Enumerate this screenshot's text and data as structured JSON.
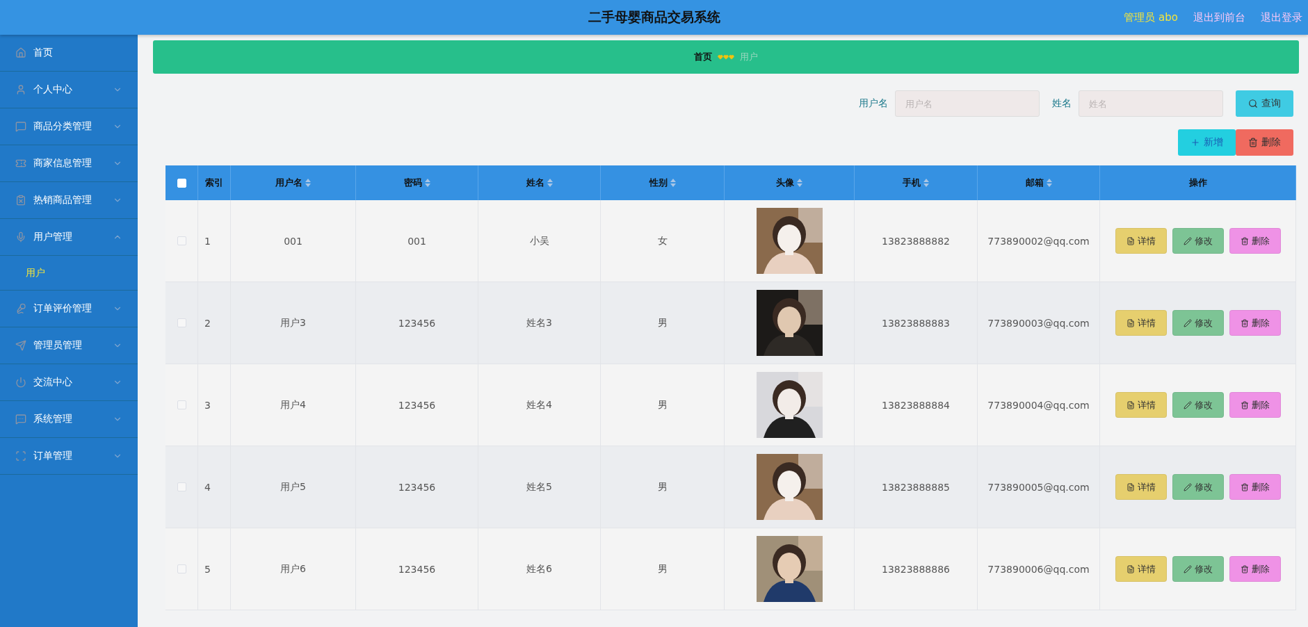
{
  "header": {
    "title": "二手母婴商品交易系统",
    "user": "管理员 abo",
    "links": [
      "退出到前台",
      "退出登录"
    ]
  },
  "sidebar": {
    "items": [
      {
        "label": "首页",
        "expandable": false
      },
      {
        "label": "个人中心",
        "expandable": true,
        "expanded": false
      },
      {
        "label": "商品分类管理",
        "expandable": true,
        "expanded": false
      },
      {
        "label": "商家信息管理",
        "expandable": true,
        "expanded": false
      },
      {
        "label": "热销商品管理",
        "expandable": true,
        "expanded": false
      },
      {
        "label": "用户管理",
        "expandable": true,
        "expanded": true,
        "children": [
          {
            "label": "用户",
            "selected": true
          }
        ]
      },
      {
        "label": "订单评价管理",
        "expandable": true,
        "expanded": false
      },
      {
        "label": "管理员管理",
        "expandable": true,
        "expanded": false
      },
      {
        "label": "交流中心",
        "expandable": true,
        "expanded": false
      },
      {
        "label": "系统管理",
        "expandable": true,
        "expanded": false
      },
      {
        "label": "订单管理",
        "expandable": true,
        "expanded": false
      }
    ]
  },
  "breadcrumb": {
    "items": [
      {
        "label": "首页",
        "current": false
      },
      {
        "label": "用户",
        "current": true
      }
    ]
  },
  "search": {
    "fields": [
      {
        "label": "用户名",
        "placeholder": "用户名"
      },
      {
        "label": "姓名",
        "placeholder": "姓名"
      }
    ],
    "button": "查询"
  },
  "actions": [
    {
      "label": "新增",
      "kind": "add"
    },
    {
      "label": "删除",
      "kind": "delete"
    }
  ],
  "table": {
    "checked_all": false,
    "columns": [
      {
        "label": "索引",
        "sortable": false
      },
      {
        "label": "用户名",
        "sortable": true
      },
      {
        "label": "密码",
        "sortable": true
      },
      {
        "label": "姓名",
        "sortable": true
      },
      {
        "label": "性别",
        "sortable": true
      },
      {
        "label": "头像",
        "sortable": true
      },
      {
        "label": "手机",
        "sortable": true
      },
      {
        "label": "邮箱",
        "sortable": true
      },
      {
        "label": "操作",
        "sortable": false
      }
    ],
    "rows": [
      {
        "checked": false,
        "cells": [
          "1",
          "001",
          "001",
          "小吴",
          "女"
        ],
        "phone": "13823888882",
        "email": "773890002@qq.com",
        "actions": [
          {
            "label": "详情",
            "kind": "detail"
          },
          {
            "label": "修改",
            "kind": "edit"
          },
          {
            "label": "删除",
            "kind": "delete"
          }
        ]
      },
      {
        "checked": false,
        "cells": [
          "2",
          "用户3",
          "123456",
          "姓名3",
          "男"
        ],
        "phone": "13823888883",
        "email": "773890003@qq.com",
        "actions": [
          {
            "label": "详情",
            "kind": "detail"
          },
          {
            "label": "修改",
            "kind": "edit"
          },
          {
            "label": "删除",
            "kind": "delete"
          }
        ]
      },
      {
        "checked": false,
        "cells": [
          "3",
          "用户4",
          "123456",
          "姓名4",
          "男"
        ],
        "phone": "13823888884",
        "email": "773890004@qq.com",
        "actions": [
          {
            "label": "详情",
            "kind": "detail"
          },
          {
            "label": "修改",
            "kind": "edit"
          },
          {
            "label": "删除",
            "kind": "delete"
          }
        ]
      },
      {
        "checked": false,
        "cells": [
          "4",
          "用户5",
          "123456",
          "姓名5",
          "男"
        ],
        "phone": "13823888885",
        "email": "773890005@qq.com",
        "actions": [
          {
            "label": "详情",
            "kind": "detail"
          },
          {
            "label": "修改",
            "kind": "edit"
          },
          {
            "label": "删除",
            "kind": "delete"
          }
        ]
      },
      {
        "checked": false,
        "cells": [
          "5",
          "用户6",
          "123456",
          "姓名6",
          "男"
        ],
        "phone": "13823888886",
        "email": "773890006@qq.com",
        "actions": [
          {
            "label": "详情",
            "kind": "detail"
          },
          {
            "label": "修改",
            "kind": "edit"
          },
          {
            "label": "删除",
            "kind": "delete"
          }
        ]
      }
    ]
  }
}
